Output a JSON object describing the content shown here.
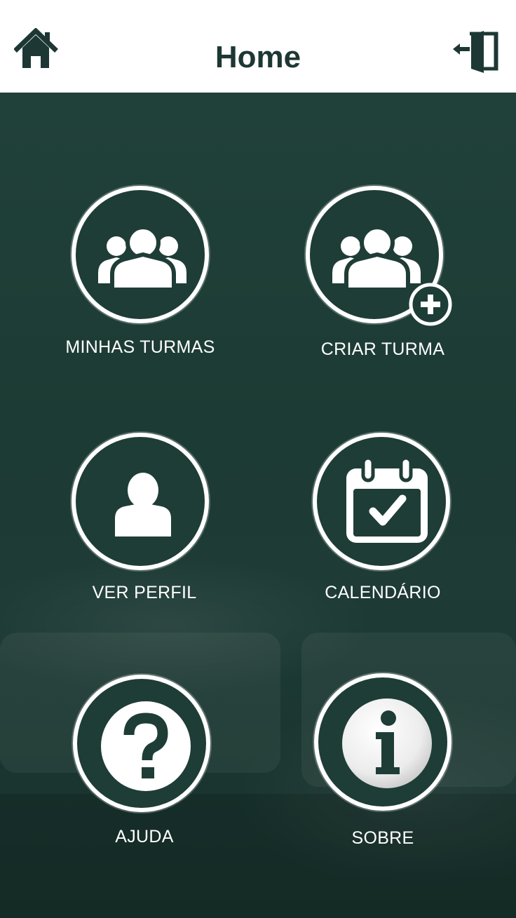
{
  "header": {
    "title": "Home",
    "home_icon": "home-icon",
    "logout_icon": "logout-door-icon"
  },
  "menu": {
    "minhas_turmas": {
      "label": "MINHAS TURMAS",
      "icon": "group-icon"
    },
    "criar_turma": {
      "label": "CRIAR TURMA",
      "icon": "group-add-icon"
    },
    "ver_perfil": {
      "label": "VER PERFIL",
      "icon": "person-icon"
    },
    "calendario": {
      "label": "CALENDÁRIO",
      "icon": "calendar-check-icon"
    },
    "ajuda": {
      "label": "AJUDA",
      "icon": "help-icon"
    },
    "sobre": {
      "label": "SOBRE",
      "icon": "info-icon"
    }
  },
  "colors": {
    "header_bg": "#ffffff",
    "title": "#1d3834",
    "background": "#1f3d38",
    "icon": "#ffffff"
  }
}
